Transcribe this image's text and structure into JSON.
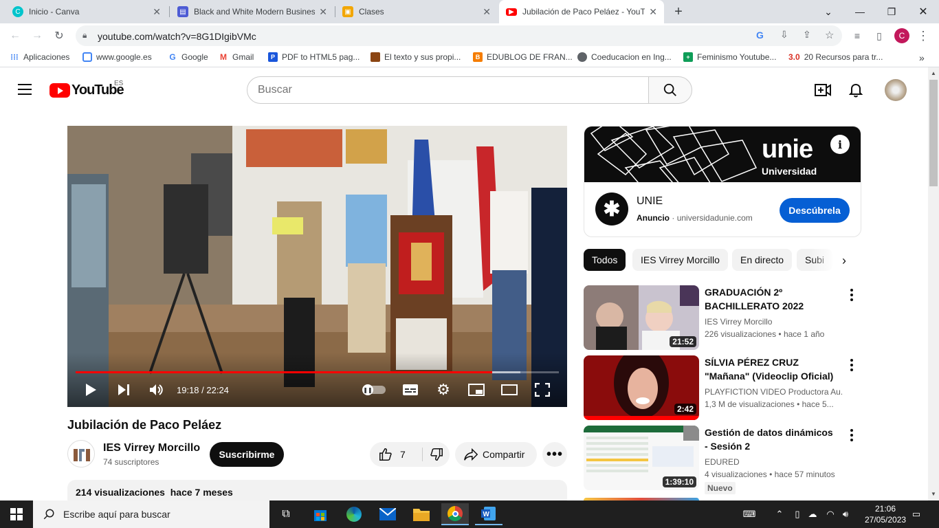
{
  "browser": {
    "tabs": [
      {
        "title": "Inicio - Canva",
        "icon": "canva-icon",
        "color": "#00c4cc"
      },
      {
        "title": "Black and White Modern Busines",
        "icon": "doc-icon",
        "color": "#4d5bd4"
      },
      {
        "title": "Clases",
        "icon": "classroom-icon",
        "color": "#f2a600"
      },
      {
        "title": "Jubilación de Paco Peláez - YouTu",
        "icon": "youtube-icon",
        "color": "#ff0000"
      }
    ],
    "new_tab": "+",
    "url": "youtube.com/watch?v=8G1DIgibVMc",
    "profile_initial": "C",
    "bookmarks": [
      {
        "label": "Aplicaciones",
        "icon": "apps-grid-icon",
        "color": "#4285f4"
      },
      {
        "label": "www.google.es",
        "icon": "globe-icon",
        "color": "#4285f4"
      },
      {
        "label": "Google",
        "icon": "google-icon",
        "color": "#4285f4"
      },
      {
        "label": "Gmail",
        "icon": "gmail-icon",
        "color": "#ea4335"
      },
      {
        "label": "PDF to HTML5 pag...",
        "icon": "pdf-icon",
        "color": "#1a56db"
      },
      {
        "label": "El texto y sus propi...",
        "icon": "book-icon",
        "color": "#8b4513"
      },
      {
        "label": "EDUBLOG DE FRAN...",
        "icon": "blogger-icon",
        "color": "#f57d00"
      },
      {
        "label": "Coeducacion en Ing...",
        "icon": "globe-icon",
        "color": "#5f6368"
      },
      {
        "label": "Feminismo Youtube...",
        "icon": "sheets-icon",
        "color": "#0f9d58"
      },
      {
        "label": "20 Recursos para tr...",
        "icon": "web30-icon",
        "color": "#d93025"
      }
    ],
    "bookmark_badge": "3.0",
    "more_bookmarks": "»"
  },
  "youtube": {
    "logo_text": "YouTube",
    "region": "ES",
    "search_placeholder": "Buscar",
    "video": {
      "title": "Jubilación de Paco Peláez",
      "time": "19:18 / 22:24",
      "progress": 0.862,
      "buffered": 0.92
    },
    "channel": {
      "name": "IES Virrey Morcillo",
      "subscribers": "74 suscriptores",
      "subscribe_label": "Suscribirme"
    },
    "actions": {
      "likes": "7",
      "share": "Compartir"
    },
    "description_head": "214 visualizaciones  hace 7 meses",
    "ad": {
      "banner_text": "unie",
      "banner_sub": "Universidad",
      "brand": "UNIE",
      "label": "Anuncio",
      "domain": "universidadunie.com",
      "cta": "Descúbrela"
    },
    "chips": [
      "Todos",
      "IES Virrey Morcillo",
      "En directo",
      "Subi"
    ],
    "recommendations": [
      {
        "title": "GRADUACIÓN 2º BACHILLERATO 2022",
        "channel": "IES Virrey Morcillo",
        "views": "226 visualizaciones",
        "age": "hace 1 año",
        "duration": "21:52"
      },
      {
        "title": "SÍLVIA PÉREZ CRUZ \"Mañana\" (Videoclip Oficial)",
        "channel": "PLAYFICTION VIDEO Productora Au...",
        "views": "1,3 M de visualizaciones",
        "age": "hace 5...",
        "duration": "2:42"
      },
      {
        "title": "Gestión de datos dinámicos - Sesión 2",
        "channel": "EDURED",
        "views": "4 visualizaciones",
        "age": "hace 57 minutos",
        "duration": "1:39:10",
        "badge": "Nuevo"
      }
    ]
  },
  "taskbar": {
    "search_placeholder": "Escribe aquí para buscar",
    "time": "21:06",
    "date": "27/05/2023"
  },
  "colors": {
    "youtube_red": "#ff0000",
    "cta_blue": "#065fd4",
    "chrome_tabstrip": "#dee1e6",
    "taskbar": "#1f1f1f"
  }
}
